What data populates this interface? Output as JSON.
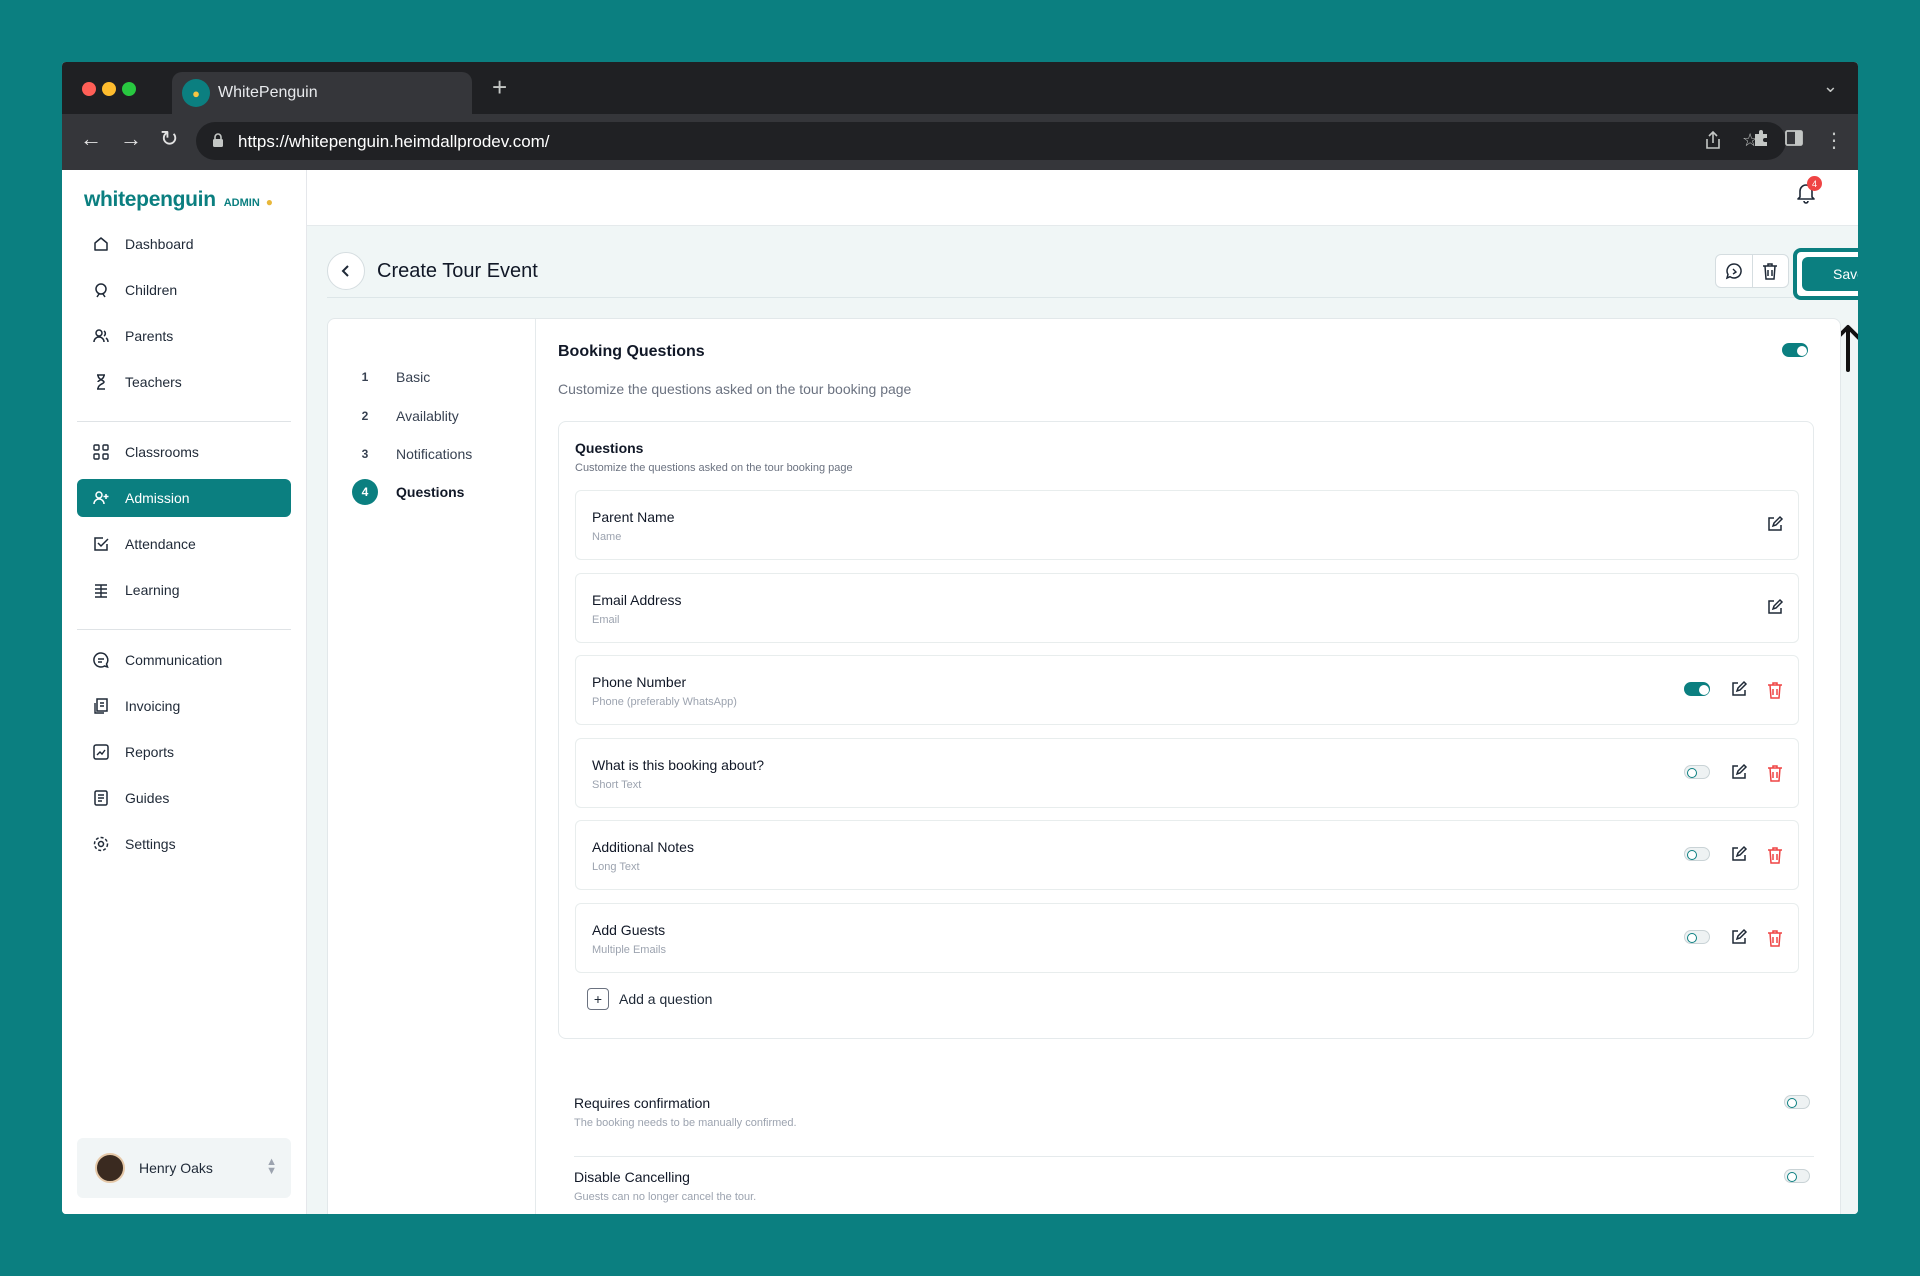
{
  "browser": {
    "tab_title": "WhitePenguin",
    "url": "https://whitepenguin.heimdallprodev.com/"
  },
  "sidebar": {
    "logo_text": "whitepenguin",
    "logo_badge": "ADMIN",
    "items": [
      {
        "label": "Dashboard",
        "icon": "home-icon"
      },
      {
        "label": "Children",
        "icon": "child-icon"
      },
      {
        "label": "Parents",
        "icon": "parents-icon"
      },
      {
        "label": "Teachers",
        "icon": "teacher-icon"
      },
      {
        "label": "Classrooms",
        "icon": "grid-icon"
      },
      {
        "label": "Admission",
        "icon": "user-plus-icon",
        "active": true
      },
      {
        "label": "Attendance",
        "icon": "checkbox-icon"
      },
      {
        "label": "Learning",
        "icon": "book-icon"
      },
      {
        "label": "Communication",
        "icon": "chat-icon"
      },
      {
        "label": "Invoicing",
        "icon": "invoice-icon"
      },
      {
        "label": "Reports",
        "icon": "chart-icon"
      },
      {
        "label": "Guides",
        "icon": "document-icon"
      },
      {
        "label": "Settings",
        "icon": "gear-icon"
      }
    ],
    "user": {
      "name": "Henry Oaks"
    }
  },
  "topbar": {
    "notification_count": "4"
  },
  "page": {
    "title": "Create Tour Event",
    "save_label": "Save"
  },
  "steps": [
    {
      "num": "1",
      "label": "Basic"
    },
    {
      "num": "2",
      "label": "Availablity"
    },
    {
      "num": "3",
      "label": "Notifications"
    },
    {
      "num": "4",
      "label": "Questions",
      "active": true
    }
  ],
  "booking": {
    "title": "Booking Questions",
    "description": "Customize the questions asked on the tour booking page",
    "enabled": true
  },
  "questions": {
    "title": "Questions",
    "description": "Customize the questions asked on the tour booking page",
    "add_label": "Add a question",
    "items": [
      {
        "name": "Parent Name",
        "type": "Name",
        "toggle": null,
        "deletable": false
      },
      {
        "name": "Email Address",
        "type": "Email",
        "toggle": null,
        "deletable": false
      },
      {
        "name": "Phone Number",
        "type": "Phone (preferably WhatsApp)",
        "toggle": true,
        "deletable": true
      },
      {
        "name": "What is this booking about?",
        "type": "Short Text",
        "toggle": false,
        "deletable": true
      },
      {
        "name": "Additional Notes",
        "type": "Long Text",
        "toggle": false,
        "deletable": true
      },
      {
        "name": "Add Guests",
        "type": "Multiple Emails",
        "toggle": false,
        "deletable": true
      }
    ]
  },
  "options": [
    {
      "title": "Requires confirmation",
      "description": "The booking needs to be manually confirmed.",
      "enabled": false
    },
    {
      "title": "Disable Cancelling",
      "description": "Guests can no longer cancel the tour.",
      "enabled": false
    }
  ],
  "colors": {
    "accent": "#0b7f80",
    "background": "#0b7f80",
    "danger": "#ef4444"
  }
}
